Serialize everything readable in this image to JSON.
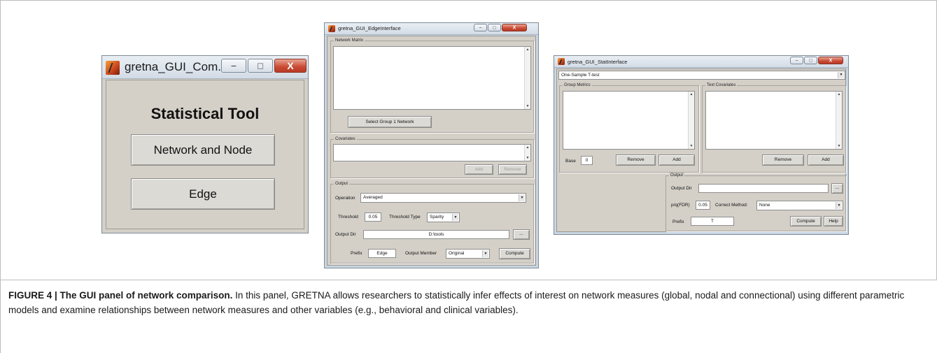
{
  "window1": {
    "title": "gretna_GUI_Com...",
    "heading": "Statistical Tool",
    "buttons": [
      "Network and Node",
      "Edge"
    ],
    "controls": {
      "minimize": "−",
      "maximize": "□",
      "close": "X"
    }
  },
  "window2": {
    "title": "gretna_GUI_EdgeInterface",
    "network_matrix_label": "Network Matrix",
    "select_button": "Select Group 1 Network",
    "covariates_label": "Covariates",
    "add_button": "Add",
    "remove_button": "Remove",
    "output_label": "Output",
    "operation_label": "Operation",
    "operation_value": "Averaged",
    "threshold_label": "Threshold",
    "threshold_value": "0.05",
    "threshold_type_label": "Threshold Type",
    "threshold_type_value": "Sparity",
    "output_dir_label": "Output Dir",
    "output_dir_value": "D:\\tools",
    "browse_button": "...",
    "prefix_label": "Prefix",
    "prefix_value": "Edge",
    "output_member_label": "Output Member",
    "output_member_value": "Original",
    "compute_button": "Compute"
  },
  "window3": {
    "title": "gretna_GUI_StatInterface",
    "test_type": "One-Sample T-test",
    "group_metrics_label": "Group Metrics",
    "text_covariates_label": "Text Covariates",
    "base_label": "Base",
    "base_value": "0",
    "remove_button": "Remove",
    "add_button": "Add",
    "output_label": "Output",
    "output_dir_label": "Output Dir",
    "browse_button": "...",
    "pq_label": "p/q(FDR)",
    "pq_value": "0.05",
    "correct_method_label": "Correct Method:",
    "correct_method_value": "None",
    "prefix_label": "Prefix",
    "prefix_value": "T",
    "compute_button": "Compute",
    "help_button": "Help"
  },
  "caption": {
    "bold": "FIGURE 4 | The GUI panel of network comparison.",
    "text": " In this panel, GRETNA allows researchers to statistically infer effects of interest on network measures (global, nodal and connectional) using different parametric models and examine relationships between network measures and other variables (e.g., behavioral and clinical variables)."
  }
}
